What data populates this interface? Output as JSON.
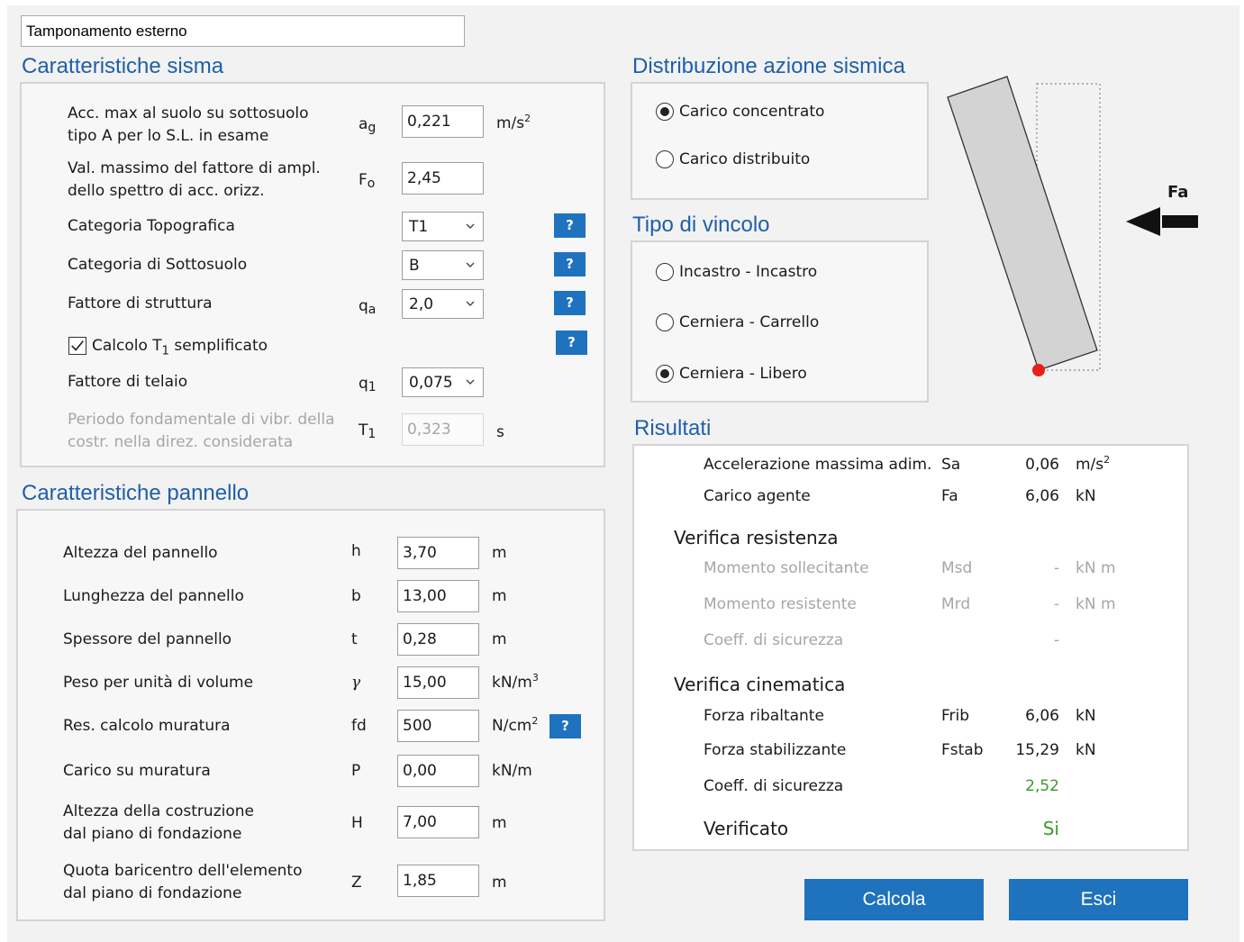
{
  "title_value": "Tamponamento esterno",
  "sisma": {
    "title": "Caratteristiche sisma",
    "ag": {
      "label1": "Acc. max al suolo su sottosuolo",
      "label2": "tipo A per lo S.L. in esame",
      "sym": "a",
      "sub": "g",
      "value": "0,221",
      "unit": "m/s",
      "sup": "2"
    },
    "fo": {
      "label1": "Val. massimo del fattore di ampl.",
      "label2": "dello spettro di acc. orizz.",
      "sym": "F",
      "sub": "o",
      "value": "2,45"
    },
    "topo": {
      "label": "Categoria Topografica",
      "value": "T1"
    },
    "sottosuolo": {
      "label": "Categoria di Sottosuolo",
      "value": "B"
    },
    "struttura": {
      "label": "Fattore di struttura",
      "sym": "q",
      "sub": "a",
      "value": "2,0"
    },
    "calcolo_t1": {
      "label_pre": "Calcolo T",
      "label_sub": "1",
      "label_post": " semplificato",
      "checked": true
    },
    "telaio": {
      "label": "Fattore di telaio",
      "sym": "q",
      "sub": "1",
      "value": "0,075"
    },
    "periodo": {
      "label1": "Periodo fondamentale di vibr. della",
      "label2": "costr. nella direz. considerata",
      "sym": "T",
      "sub": "1",
      "value": "0,323",
      "unit": "s"
    },
    "help": "?"
  },
  "pannello": {
    "title": "Caratteristiche pannello",
    "rows": [
      {
        "label": "Altezza del pannello",
        "sym": "h",
        "value": "3,70",
        "unit": "m"
      },
      {
        "label": "Lunghezza del pannello",
        "sym": "b",
        "value": "13,00",
        "unit": "m"
      },
      {
        "label": "Spessore del pannello",
        "sym": "t",
        "value": "0,28",
        "unit": "m"
      },
      {
        "label": "Peso per unità di volume",
        "sym": "γ",
        "value": "15,00",
        "unit": "kN/m",
        "sup": "3"
      },
      {
        "label": "Res. calcolo muratura",
        "sym": "fd",
        "value": "500",
        "unit": "N/cm",
        "sup": "2"
      },
      {
        "label": "Carico su muratura",
        "sym": "P",
        "value": "0,00",
        "unit": "kN/m"
      }
    ],
    "altezza_costr": {
      "label1": "Altezza della costruzione",
      "label2": "dal piano di fondazione",
      "sym": "H",
      "value": "7,00",
      "unit": "m"
    },
    "quota": {
      "label1": "Quota baricentro dell'elemento",
      "label2": "dal piano di fondazione",
      "sym": "Z",
      "value": "1,85",
      "unit": "m"
    }
  },
  "distribuzione": {
    "title": "Distribuzione azione sismica",
    "options": [
      "Carico concentrato",
      "Carico distribuito"
    ],
    "selected": 0
  },
  "vincolo": {
    "title": "Tipo di vincolo",
    "options": [
      "Incastro - Incastro",
      "Cerniera - Carrello",
      "Cerniera - Libero"
    ],
    "selected": 2
  },
  "diagram": {
    "force_label": "Fa"
  },
  "risultati": {
    "title": "Risultati",
    "acc": {
      "label": "Accelerazione massima adim.",
      "sym": "Sa",
      "value": "0,06",
      "unit": "m/s",
      "sup": "2"
    },
    "carico": {
      "label": "Carico agente",
      "sym": "Fa",
      "value": "6,06",
      "unit": "kN"
    },
    "resistenza_title": "Verifica resistenza",
    "msd": {
      "label": "Momento sollecitante",
      "sym": "Msd",
      "value": "-",
      "unit": "kN m"
    },
    "mrd": {
      "label": "Momento resistente",
      "sym": "Mrd",
      "value": "-",
      "unit": "kN m"
    },
    "coeff_res": {
      "label": "Coeff. di sicurezza",
      "value": "-"
    },
    "cinematica_title": "Verifica cinematica",
    "frib": {
      "label": "Forza ribaltante",
      "sym": "Frib",
      "value": "6,06",
      "unit": "kN"
    },
    "fstab": {
      "label": "Forza stabilizzante",
      "sym": "Fstab",
      "value": "15,29",
      "unit": "kN"
    },
    "coeff_cin": {
      "label": "Coeff. di sicurezza",
      "value": "2,52"
    },
    "verificato": {
      "label": "Verificato",
      "value": "Si"
    }
  },
  "buttons": {
    "calcola": "Calcola",
    "esci": "Esci"
  },
  "colors": {
    "accent": "#1e72be",
    "title": "#1f5fa8",
    "ok": "#3a9a2a",
    "pivot": "#e8201a"
  }
}
